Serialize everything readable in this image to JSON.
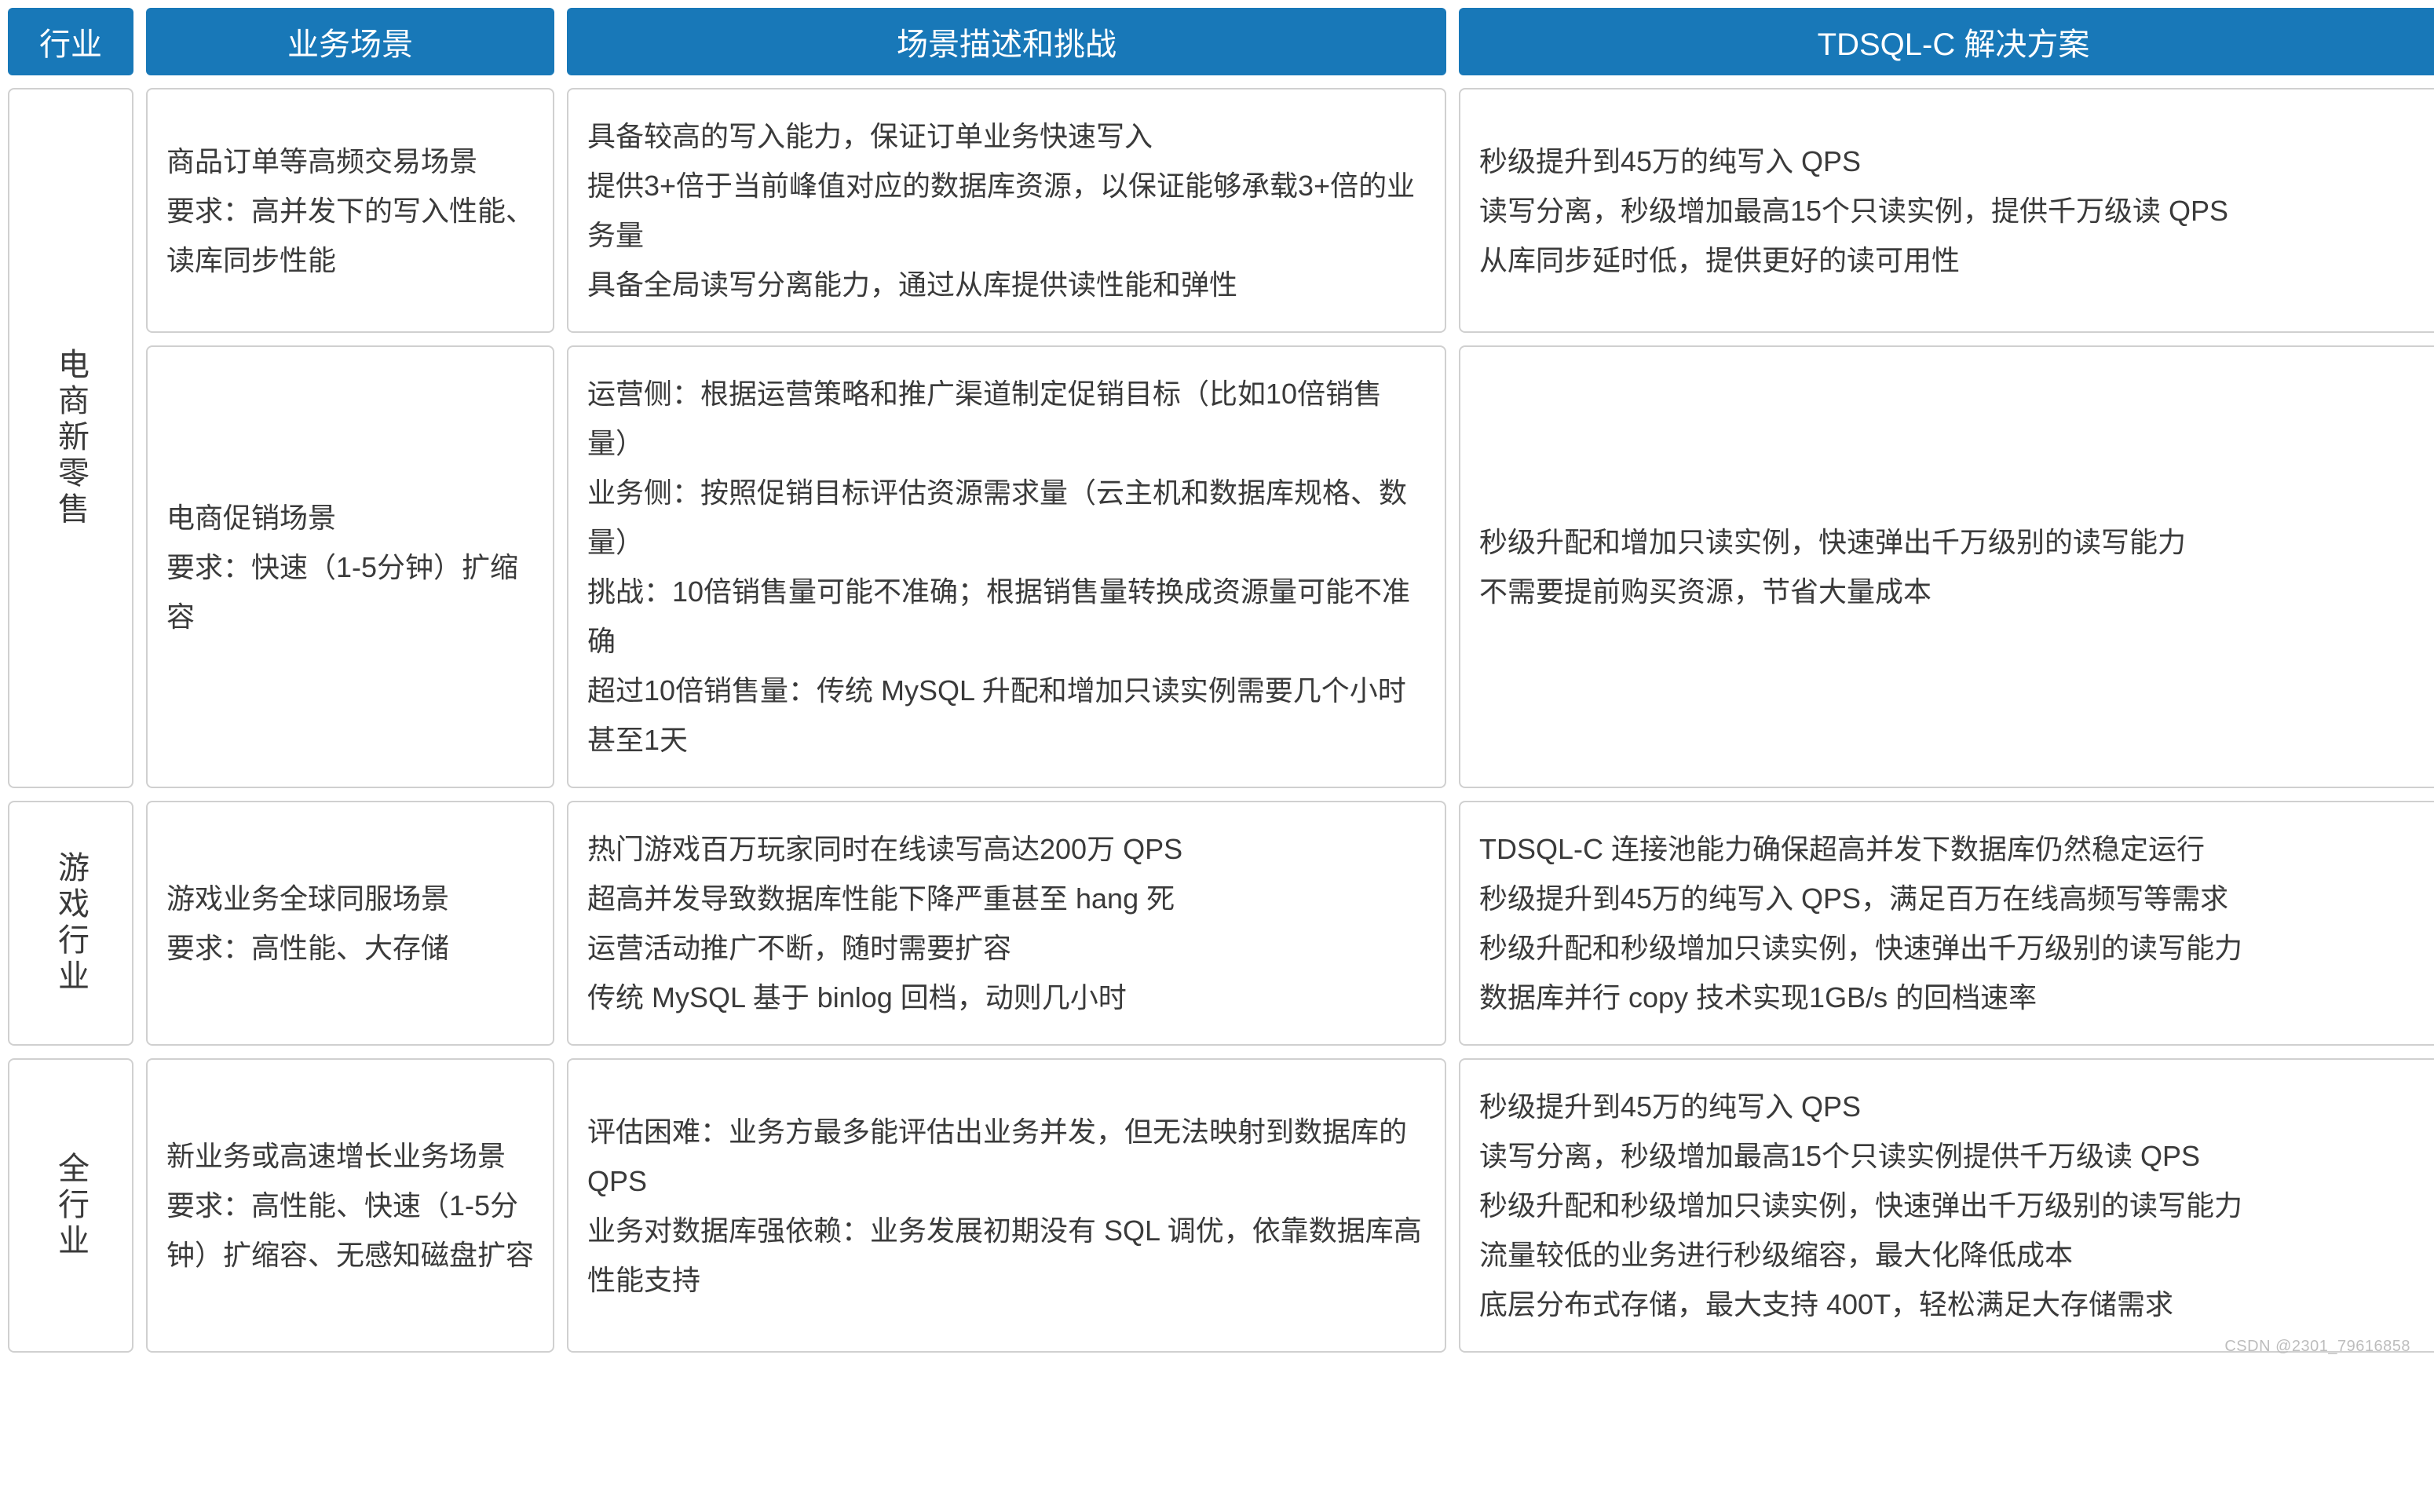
{
  "headers": {
    "industry": "行业",
    "scenario": "业务场景",
    "challenges": "场景描述和挑战",
    "solution": "TDSQL-C 解决方案"
  },
  "watermark": "CSDN @2301_79616858",
  "rows": [
    {
      "industry": "电商新零售",
      "subrows": [
        {
          "scenario": "商品订单等高频交易场景\n要求：高并发下的写入性能、读库同步性能",
          "challenge": "具备较高的写入能力，保证订单业务快速写入\n提供3+倍于当前峰值对应的数据库资源，以保证能够承载3+倍的业务量\n具备全局读写分离能力，通过从库提供读性能和弹性",
          "solution": "秒级提升到45万的纯写入 QPS\n读写分离，秒级增加最高15个只读实例，提供千万级读 QPS\n从库同步延时低，提供更好的读可用性"
        },
        {
          "scenario": "电商促销场景\n要求：快速（1-5分钟）扩缩容",
          "challenge": "运营侧：根据运营策略和推广渠道制定促销目标（比如10倍销售量）\n业务侧：按照促销目标评估资源需求量（云主机和数据库规格、数量）\n挑战：10倍销售量可能不准确；根据销售量转换成资源量可能不准确\n超过10倍销售量：传统 MySQL 升配和增加只读实例需要几个小时甚至1天",
          "solution": "秒级升配和增加只读实例，快速弹出千万级别的读写能力\n不需要提前购买资源，节省大量成本"
        }
      ]
    },
    {
      "industry": "游戏行业",
      "subrows": [
        {
          "scenario": "游戏业务全球同服场景\n要求：高性能、大存储",
          "challenge": "热门游戏百万玩家同时在线读写高达200万 QPS\n超高并发导致数据库性能下降严重甚至 hang 死\n运营活动推广不断，随时需要扩容\n传统 MySQL 基于 binlog 回档，动则几小时",
          "solution": "TDSQL-C 连接池能力确保超高并发下数据库仍然稳定运行\n秒级提升到45万的纯写入 QPS，满足百万在线高频写等需求\n秒级升配和秒级增加只读实例，快速弹出千万级别的读写能力\n数据库并行 copy 技术实现1GB/s 的回档速率"
        }
      ]
    },
    {
      "industry": "全行业",
      "subrows": [
        {
          "scenario": "新业务或高速增长业务场景\n要求：高性能、快速（1-5分钟）扩缩容、无感知磁盘扩容",
          "challenge": "评估困难：业务方最多能评估出业务并发，但无法映射到数据库的 QPS\n业务对数据库强依赖：业务发展初期没有 SQL 调优，依靠数据库高性能支持",
          "solution": "秒级提升到45万的纯写入 QPS\n读写分离，秒级增加最高15个只读实例提供千万级读 QPS\n秒级升配和秒级增加只读实例，快速弹出千万级别的读写能力\n流量较低的业务进行秒级缩容，最大化降低成本\n底层分布式存储，最大支持 400T，轻松满足大存储需求"
        }
      ]
    }
  ]
}
